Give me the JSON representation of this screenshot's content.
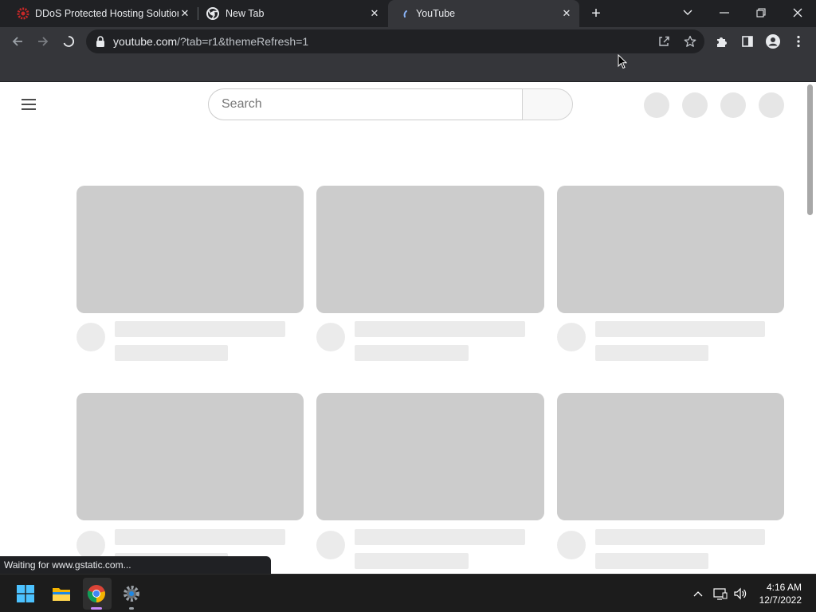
{
  "browser": {
    "tabs": [
      {
        "title": "DDoS Protected Hosting Solution",
        "favicon": "red-gear-icon",
        "active": false
      },
      {
        "title": "New Tab",
        "favicon": "chrome-icon",
        "active": false
      },
      {
        "title": "YouTube",
        "favicon": "loading-spinner-icon",
        "active": true
      }
    ],
    "new_tab_label": "+",
    "omnibox": {
      "host": "youtube.com",
      "path": "/?tab=r1&themeRefresh=1"
    }
  },
  "page": {
    "search_placeholder": "Search"
  },
  "status": {
    "text": "Waiting for www.gstatic.com..."
  },
  "taskbar": {
    "time": "4:16 AM",
    "date": "12/7/2022"
  },
  "colors": {
    "tab_strip": "#202124",
    "toolbar": "#35363a",
    "skeleton_thumb": "#cccccc",
    "skeleton_line": "#ebebeb",
    "taskbar": "#1c1c1c"
  }
}
